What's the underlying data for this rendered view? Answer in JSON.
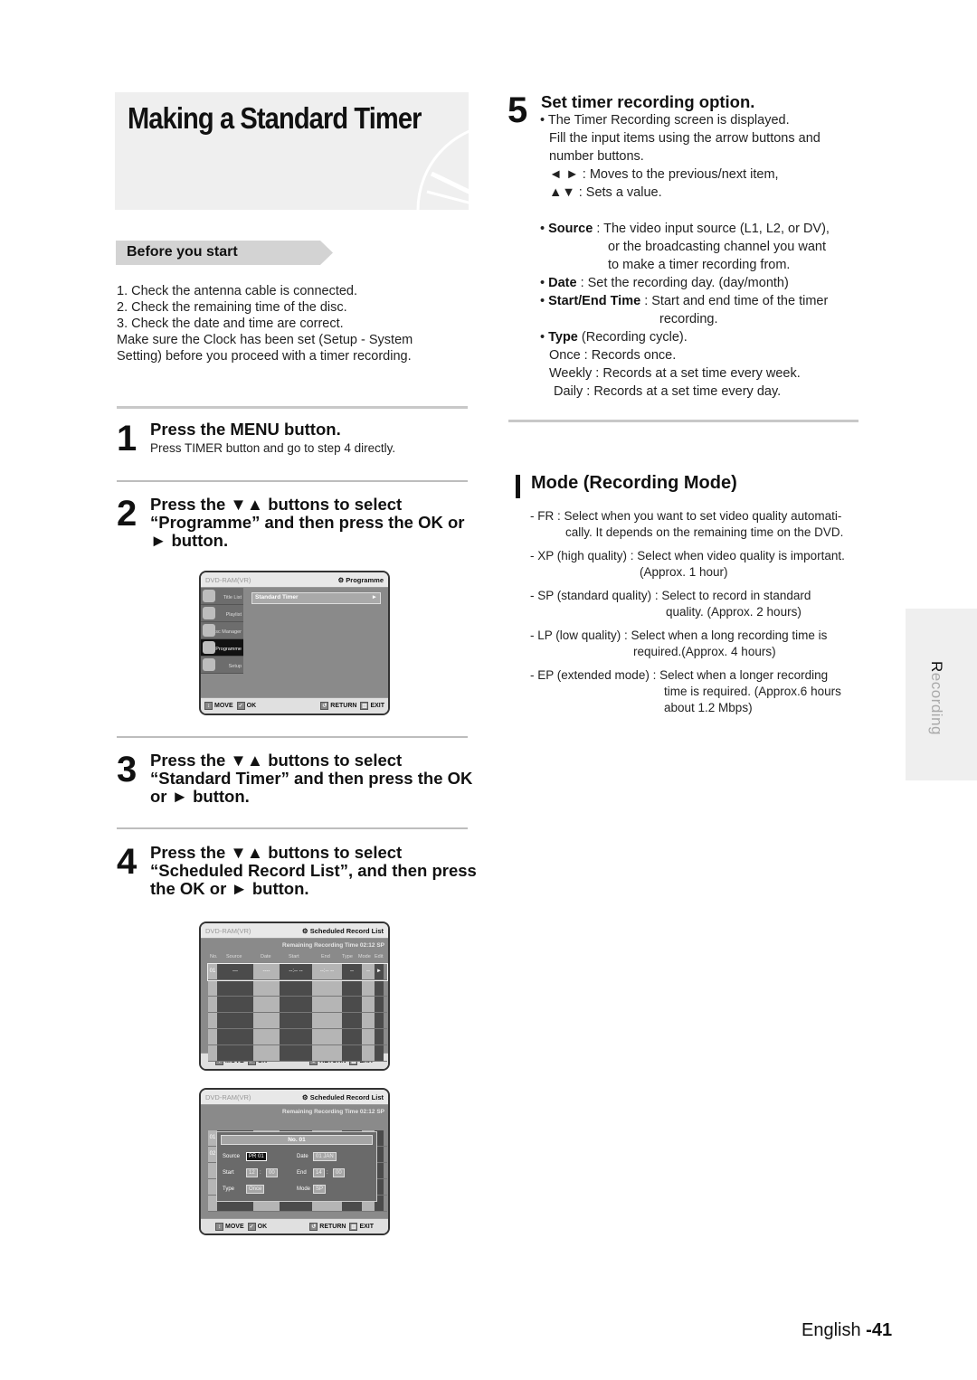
{
  "title": "Making a Standard Timer",
  "before_you_start": {
    "label": "Before you start",
    "lines": [
      "1. Check the antenna cable is connected.",
      "2. Check the remaining time of the disc.",
      "3. Check the date and time are correct.",
      "Make sure the Clock has been set (Setup - System",
      "Setting) before you proceed with a timer recording."
    ]
  },
  "steps": [
    {
      "num": "1",
      "lines": [
        "Press the MENU button."
      ],
      "sub": "Press TIMER button and go to step 4 directly."
    },
    {
      "num": "2",
      "lines": [
        "Press the ▼▲ buttons to select",
        "“Programme” and then press the OK or",
        "► button."
      ]
    },
    {
      "num": "3",
      "lines": [
        "Press the ▼▲ buttons to select",
        "“Standard Timer” and then press the OK",
        "or ► button."
      ]
    },
    {
      "num": "4",
      "lines": [
        "Press the ▼▲ buttons to select",
        "“Scheduled Record List”, and then press",
        "the OK or ► button."
      ]
    }
  ],
  "osd_common": {
    "device": "DVD-RAM(VR)",
    "bottom": {
      "move": "MOVE",
      "ok": "OK",
      "return": "RETURN",
      "exit": "EXIT"
    }
  },
  "osd_programme": {
    "title": "⚙ Programme",
    "menu": [
      "Title List",
      "Playlist",
      "Disc Manager",
      "Programme",
      "Setup"
    ],
    "active_index": 3,
    "item": "Standard Timer",
    "item_arrow": "►"
  },
  "osd_list": {
    "title": "⚙ Scheduled Record List",
    "remaining": "Remaining Recording Time 02:12 SP",
    "columns": [
      "No.",
      "Source",
      "Date",
      "Start",
      "End",
      "Type",
      "Mode",
      "Edit"
    ],
    "row1": [
      "01",
      "---",
      "----",
      "--:-- --",
      "--:-- --",
      "--",
      "--",
      "►"
    ]
  },
  "osd_edit": {
    "title": "⚙ Scheduled Record List",
    "remaining": "Remaining Recording Time 02:12 SP",
    "rows": [
      "01",
      "02"
    ],
    "popup_title": "No. 01",
    "fields": {
      "source_label": "Source",
      "source_value": "PR 01",
      "date_label": "Date",
      "date_value": "01 JAN",
      "start_label": "Start",
      "start_h": "12",
      "start_m": "00",
      "end_label": "End",
      "end_h": "14",
      "end_m": "00",
      "type_label": "Type",
      "type_value": "Once",
      "mode_label": "Mode",
      "mode_value": "SP",
      "sep": ":"
    }
  },
  "step5": {
    "num": "5",
    "head": "Set timer recording option.",
    "lines": [
      "• The Timer Recording screen is displayed.",
      "Fill the input items using the arrow buttons and",
      "number buttons.",
      "◄ ► : Moves to the previous/next item,",
      "▲▼ : Sets a value."
    ],
    "items": {
      "source_key": "Source",
      "source_text": ": The video input source (L1, L2, or DV),",
      "source_2": "or the broadcasting channel you want",
      "source_3": "to make a timer recording from.",
      "date_key": "Date",
      "date_text": ": Set the recording day. (day/month)",
      "time_key": "Start/End Time",
      "time_text": ": Start and end time of the timer",
      "time_2": "recording.",
      "type_key": "Type",
      "type_text": "(Recording cycle).",
      "once": "Once : Records once.",
      "weekly": "Weekly : Records at a set time every week.",
      "daily": "Daily : Records at a set time every day."
    }
  },
  "mode": {
    "title": "Mode (Recording Mode)",
    "items": [
      [
        "- FR : Select when you want to set video quality automati-",
        "cally. It depends on the remaining time on the DVD."
      ],
      [
        "- XP (high quality) : Select when video quality is important.",
        "(Approx. 1 hour)"
      ],
      [
        "- SP (standard quality) : Select to record in standard",
        "quality. (Approx. 2 hours)"
      ],
      [
        "- LP (low quality) : Select when a long recording time is",
        "required.(Approx. 4 hours)"
      ],
      [
        "- EP (extended mode) : Select when a longer recording",
        "time is required. (Approx.6 hours",
        "about 1.2 Mbps)"
      ]
    ]
  },
  "side_tab": {
    "first": "R",
    "rest": "ecording"
  },
  "footer": {
    "lang": "English",
    "page": "-41"
  }
}
